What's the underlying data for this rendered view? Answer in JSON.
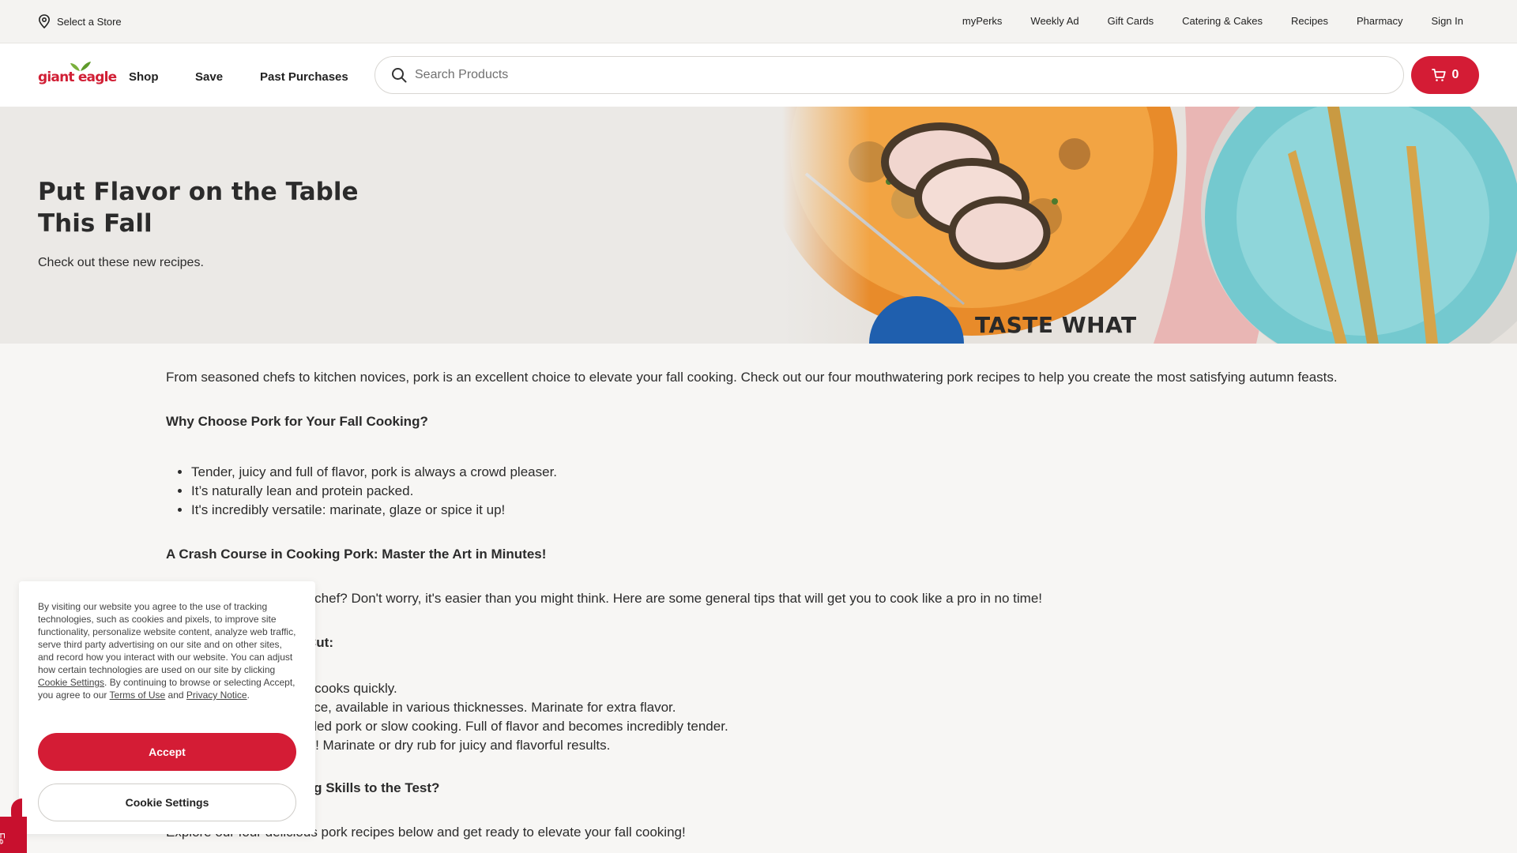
{
  "utility_bar": {
    "store_label": "Select a Store",
    "links": [
      "myPerks",
      "Weekly Ad",
      "Gift Cards",
      "Catering & Cakes",
      "Recipes",
      "Pharmacy",
      "Sign In"
    ]
  },
  "main_nav": {
    "logo_text": "giant eagle",
    "items": [
      "Shop",
      "Save",
      "Past Purchases"
    ],
    "search_placeholder": "Search Products",
    "search_value": "",
    "cart_count": "0"
  },
  "hero": {
    "title": "Put Flavor on the Table This Fall",
    "subtitle": "Check out these new recipes.",
    "image_text": "TASTE WHAT"
  },
  "article": {
    "intro": "From seasoned chefs to kitchen novices, pork is an excellent choice to elevate your fall cooking. Check out our four mouthwatering pork recipes to help you create the most satisfying autumn feasts.",
    "heading1": "Why Choose Pork for Your Fall Cooking?",
    "list1": [
      "Tender, juicy and full of flavor, pork is always a crowd pleaser.",
      "It’s naturally lean and protein packed.",
      "It's incredibly versatile: marinate, glaze or spice it up!"
    ],
    "heading2": "A Crash Course in Cooking Pork: Master the Art in Minutes!",
    "para2": "d chef? Don't worry, it's easier than you might think. Here are some general tips that will get you to cook like a pro in no time!",
    "heading3": "Cut:",
    "list2": [
      "d cooks quickly.",
      "oice, available in various thicknesses. Marinate for extra flavor.",
      "ulled pork or slow cooking. Full of flavor and becomes incredibly tender.",
      "er! Marinate or dry rub for juicy and flavorful results."
    ],
    "heading4": "ing Skills to the Test?",
    "para4": "Explore our four delicious pork recipes below and get ready to elevate your fall cooking!"
  },
  "cookie_banner": {
    "text_part1": "By visiting our website you agree to the use of tracking technologies, such as cookies and pixels, to improve site functionality, personalize website content, analyze web traffic, serve third party advertising on our site and on other sites, and record how you interact with our website. You can adjust how certain technologies are used on our site by clicking ",
    "link_cookie_settings": "Cookie Settings",
    "text_part2": ". By continuing to browse or selecting Accept, you agree to our ",
    "link_terms": "Terms of Use",
    "text_and": " and ",
    "link_privacy": "Privacy Notice",
    "text_end": ".",
    "accept_label": "Accept",
    "settings_label": "Cookie Settings"
  },
  "feedback_tab": {
    "label": "Fe"
  },
  "colors": {
    "brand_red": "#d41c35",
    "page_bg": "#f7f6f4",
    "hero_bg": "#ebe9e6"
  }
}
